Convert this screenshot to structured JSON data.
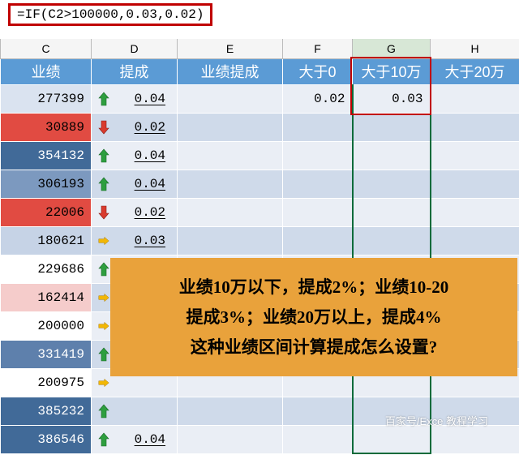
{
  "formula": "=IF(C2>100000,0.03,0.02)",
  "cols": {
    "C": "C",
    "D": "D",
    "E": "E",
    "F": "F",
    "G": "G",
    "H": "H"
  },
  "headers": {
    "c": "业绩",
    "d": "提成",
    "e": "业绩提成",
    "f": "大于0",
    "g": "大于10万",
    "h": "大于20万"
  },
  "rows": [
    {
      "yeji": "277399",
      "dir": "up",
      "ticheng": "0.04",
      "cbg": "#dae3f0",
      "f": "0.02",
      "g": "0.03"
    },
    {
      "yeji": "30889",
      "dir": "down",
      "ticheng": "0.02",
      "cbg": "#e14b42"
    },
    {
      "yeji": "354132",
      "dir": "up",
      "ticheng": "0.04",
      "cbg": "#416a98"
    },
    {
      "yeji": "306193",
      "dir": "up",
      "ticheng": "0.04",
      "cbg": "#7c99bf"
    },
    {
      "yeji": "22006",
      "dir": "down",
      "ticheng": "0.02",
      "cbg": "#e14b42"
    },
    {
      "yeji": "180621",
      "dir": "right",
      "ticheng": "0.03",
      "cbg": "#c6d3e6"
    },
    {
      "yeji": "229686",
      "dir": "up",
      "ticheng": "",
      "cbg": "#ffffff"
    },
    {
      "yeji": "162414",
      "dir": "right",
      "ticheng": "",
      "cbg": "#f5cccb"
    },
    {
      "yeji": "200000",
      "dir": "right",
      "ticheng": "",
      "cbg": "#ffffff"
    },
    {
      "yeji": "331419",
      "dir": "up",
      "ticheng": "",
      "cbg": "#5e80ac"
    },
    {
      "yeji": "200975",
      "dir": "right",
      "ticheng": "",
      "cbg": "#ffffff"
    },
    {
      "yeji": "385232",
      "dir": "up",
      "ticheng": "",
      "cbg": "#416a98"
    },
    {
      "yeji": "386546",
      "dir": "up",
      "ticheng": "0.04",
      "cbg": "#416a98"
    }
  ],
  "annotation": {
    "l1": "业绩10万以下，提成2%；业绩10-20",
    "l2": "提成3%；业绩20万以上，提成4%",
    "l3": "这种业绩区间计算提成怎么设置?"
  },
  "watermark": "百家号/Exce  教程学习"
}
